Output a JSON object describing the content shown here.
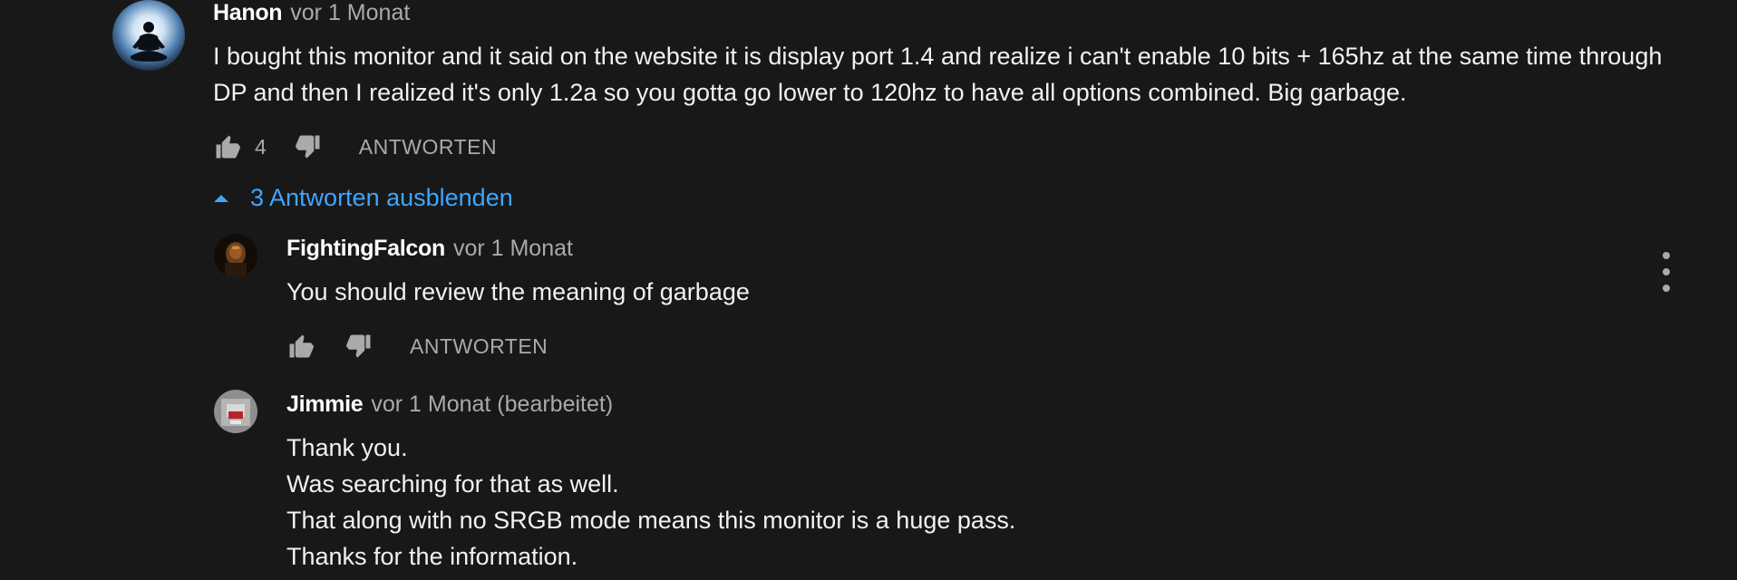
{
  "colors": {
    "background": "#181818",
    "text": "#f1f1f1",
    "secondary_text": "#aaaaaa",
    "link": "#3ea6ff"
  },
  "comment": {
    "author": "Hanon",
    "time": "vor 1 Monat",
    "text": "I bought this monitor and it said on the website it is display port 1.4 and realize i can't enable 10 bits + 165hz at the same time through DP and then I realized it's only 1.2a so you gotta go lower to 120hz to have all options combined. Big garbage.",
    "likes": "4",
    "reply_label": "ANTWORTEN",
    "avatar_icon": "meditation-avatar-icon"
  },
  "replies_toggle": {
    "label": "3 Antworten ausblenden",
    "icon": "caret-up-icon"
  },
  "replies": [
    {
      "author": "FightingFalcon",
      "time": "vor 1 Monat",
      "text": "You should review the meaning of garbage",
      "likes": "",
      "reply_label": "ANTWORTEN"
    },
    {
      "author": "Jimmie",
      "time": "vor 1 Monat (bearbeitet)",
      "text": "Thank you.\nWas searching for that as well.\nThat along with no SRGB mode means this monitor is a huge pass.\nThanks for the information."
    }
  ],
  "icons": {
    "like": "thumbs-up-icon",
    "dislike": "thumbs-down-icon",
    "more": "more-vert-icon"
  }
}
